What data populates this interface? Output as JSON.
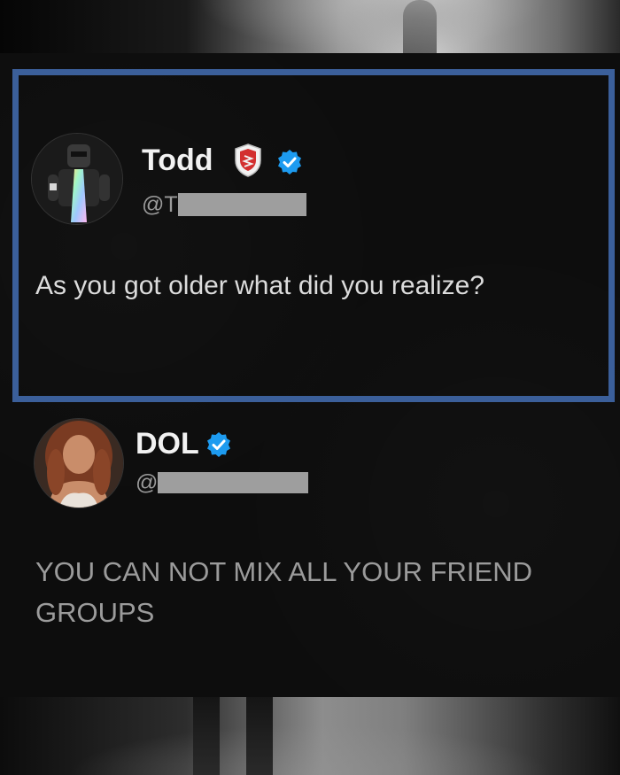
{
  "tweet1": {
    "name": "Todd",
    "handle_prefix": "@T",
    "text": "As you got older what did you realize?"
  },
  "tweet2": {
    "name": "DOL",
    "handle_prefix": "@",
    "text_line1": "YOU CAN NOT MIX ALL YOUR FRIEND",
    "text_line2": "GROUPS"
  },
  "icons": {
    "verified": "verified-badge-icon",
    "shield": "shield-affiliation-icon"
  },
  "colors": {
    "highlight_border": "#3b5f9a",
    "verified_blue": "#1d9bf0",
    "redaction": "#9e9e9e"
  }
}
